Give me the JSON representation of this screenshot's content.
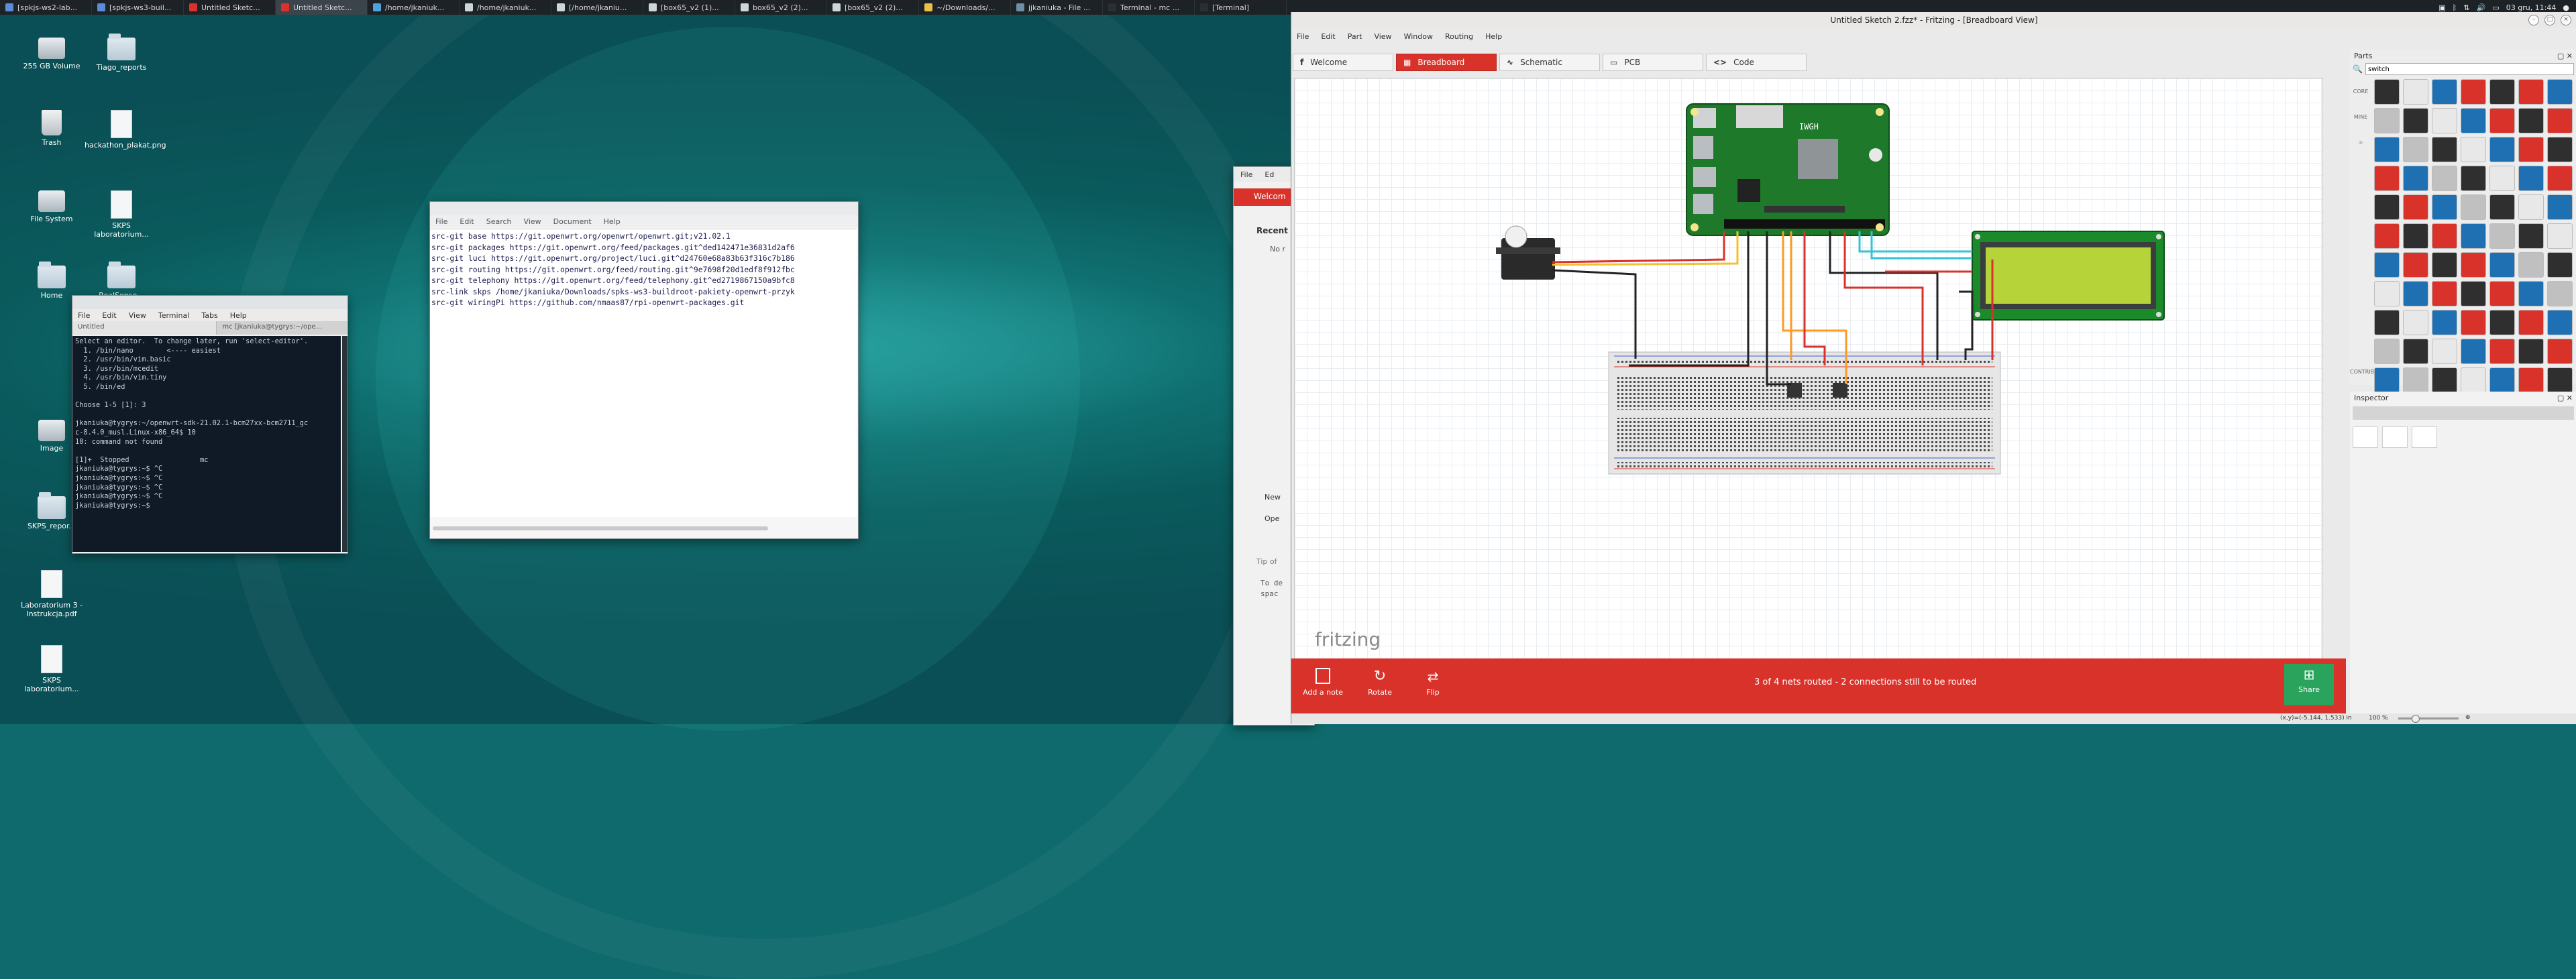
{
  "taskbar": {
    "tasks": [
      {
        "label": "[spkjs-ws2-lab...",
        "color": "#5b8dd6"
      },
      {
        "label": "[spkjs-ws3-buil...",
        "color": "#5b8dd6"
      },
      {
        "label": "Untitled Sketc...",
        "color": "#d9322a"
      },
      {
        "label": "Untitled Sketc...",
        "color": "#d9322a"
      },
      {
        "label": "/home/jkaniuk...",
        "color": "#4fa3d9"
      },
      {
        "label": "/home/jkaniuk...",
        "color": "#cfd6da"
      },
      {
        "label": "[/home/jkaniu...",
        "color": "#cfd6da"
      },
      {
        "label": "[box65_v2 (1)...",
        "color": "#cfd6da"
      },
      {
        "label": "box65_v2 (2)...",
        "color": "#cfd6da"
      },
      {
        "label": "[box65_v2 (2)...",
        "color": "#cfd6da"
      },
      {
        "label": "~/Downloads/...",
        "color": "#e8c04a"
      },
      {
        "label": "jjkaniuka - File ...",
        "color": "#6f8fa6"
      },
      {
        "label": "Terminal - mc ...",
        "color": "#2a2f33"
      },
      {
        "label": "[Terminal]",
        "color": "#2a2f33"
      }
    ],
    "clock": "03 gru, 11:44"
  },
  "desktop_icons": [
    {
      "label": "255 GB Volume",
      "type": "drive"
    },
    {
      "label": "Tiago_reports",
      "type": "folder"
    },
    {
      "label": "Trash",
      "type": "trash"
    },
    {
      "label": "hackathon_plakat.png",
      "type": "image"
    },
    {
      "label": "File System",
      "type": "drive"
    },
    {
      "label": "SKPS laboratorium...",
      "type": "file"
    },
    {
      "label": "Home",
      "type": "folder"
    },
    {
      "label": "RealSense...",
      "type": "folder"
    },
    {
      "label": "Image",
      "type": "drive"
    },
    {
      "label": "SKPS_repor...",
      "type": "folder"
    },
    {
      "label": "Laboratorium 3 - Instrukcja.pdf",
      "type": "file"
    },
    {
      "label": "SKPS laboratorium...",
      "type": "file"
    }
  ],
  "terminal": {
    "menu": [
      "File",
      "Edit",
      "View",
      "Terminal",
      "Tabs",
      "Help"
    ],
    "tabs": [
      "Untitled",
      "mc [jkaniuka@tygrys:~/ope..."
    ],
    "lines": [
      "Select an editor.  To change later, run 'select-editor'.",
      "  1. /bin/nano        <---- easiest",
      "  2. /usr/bin/vim.basic",
      "  3. /usr/bin/mcedit",
      "  4. /usr/bin/vim.tiny",
      "  5. /bin/ed",
      "",
      "Choose 1-5 [1]: 3",
      "",
      "jkaniuka@tygrys:~/openwrt-sdk-21.02.1-bcm27xx-bcm2711_gc",
      "c-8.4.0_musl.Linux-x86_64$ 10",
      "10: command not found",
      "",
      "[1]+  Stopped                 mc",
      "jkaniuka@tygrys:~$ ^C",
      "jkaniuka@tygrys:~$ ^C",
      "jkaniuka@tygrys:~$ ^C",
      "jkaniuka@tygrys:~$ ^C",
      "jkaniuka@tygrys:~$ "
    ]
  },
  "editor": {
    "menu": [
      "File",
      "Edit",
      "Search",
      "View",
      "Document",
      "Help"
    ],
    "lines": [
      "src-git base https://git.openwrt.org/openwrt/openwrt.git;v21.02.1",
      "src-git packages https://git.openwrt.org/feed/packages.git^ded142471e36831d2af6",
      "src-git luci https://git.openwrt.org/project/luci.git^d24760e68a83b63f316c7b186",
      "src-git routing https://git.openwrt.org/feed/routing.git^9e7698f20d1edf8f912fbc",
      "src-git telephony https://git.openwrt.org/feed/telephony.git^ed2719867150a9bfc8",
      "src-link skps /home/jkaniuka/Downloads/spks-ws3-buildroot-pakiety-openwrt-przyk",
      "src-git wiringPi https://github.com/nmaas87/rpi-openwrt-packages.git"
    ]
  },
  "mid_window": {
    "menu": [
      "File",
      "Ed"
    ],
    "tab": "Welcom",
    "recent": "Recent",
    "no_recent": "No r",
    "new": "New",
    "open": "Ope",
    "tip_title": "Tip of",
    "tip_text": [
      "To de",
      "spac"
    ]
  },
  "fritzing": {
    "title": "Untitled Sketch 2.fzz* - Fritzing - [Breadboard View]",
    "menu": [
      "File",
      "Edit",
      "Part",
      "View",
      "Window",
      "Routing",
      "Help"
    ],
    "tabs": [
      {
        "label": "Welcome",
        "icon": "fritzing-f-icon",
        "active": false
      },
      {
        "label": "Breadboard",
        "icon": "breadboard-icon",
        "active": true
      },
      {
        "label": "Schematic",
        "icon": "schematic-icon",
        "active": false
      },
      {
        "label": "PCB",
        "icon": "pcb-icon",
        "active": false
      },
      {
        "label": "Code",
        "icon": "code-icon",
        "active": false
      }
    ],
    "logo_text": "fritzing",
    "board_label": "IWGH",
    "bottom": {
      "add_note": "Add a note",
      "rotate": "Rotate",
      "flip": "Flip",
      "routing_status": "3 of 4 nets routed - 2 connections still to be routed",
      "share": "Share"
    },
    "status": {
      "coords": "(x,y)=(-5.144, 1.533) in",
      "zoom": "100 %"
    },
    "parts_panel": {
      "title": "Parts",
      "search_value": "switch",
      "categories": [
        "CORE",
        "MINE",
        "∞",
        "",
        "",
        "",
        "",
        "",
        "",
        "",
        "",
        "CONTRIB"
      ]
    },
    "inspector": {
      "title": "Inspector"
    },
    "accent_color": "#d9322a",
    "share_color": "#2aa35c"
  }
}
